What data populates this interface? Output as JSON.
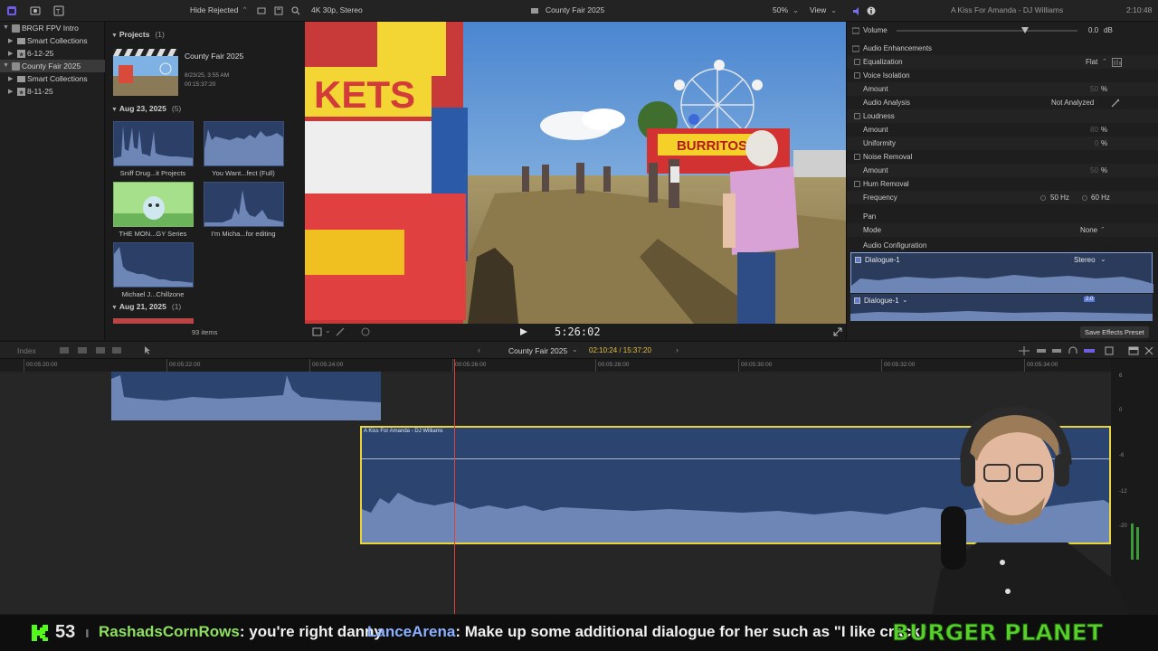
{
  "toolbar": {
    "hide_rejected": "Hide Rejected",
    "format": "4K 30p, Stereo",
    "project_title": "County Fair 2025",
    "zoom": "50%",
    "view": "View",
    "inspector_title": "A Kiss For Amanda - DJ Williams",
    "inspector_duration": "2:10:48"
  },
  "libraries": {
    "items": [
      {
        "label": "BRGR FPV Intro",
        "level": 0,
        "type": "library"
      },
      {
        "label": "Smart Collections",
        "level": 1,
        "type": "folder"
      },
      {
        "label": "6-12-25",
        "level": 1,
        "type": "event"
      },
      {
        "label": "County Fair 2025",
        "level": 0,
        "type": "library",
        "selected": true
      },
      {
        "label": "Smart Collections",
        "level": 1,
        "type": "folder"
      },
      {
        "label": "8-11-25",
        "level": 1,
        "type": "event"
      }
    ]
  },
  "browser": {
    "projects_header": "Projects",
    "projects_count": "(1)",
    "project": {
      "name": "County Fair 2025",
      "date": "8/23/25, 3:55 AM",
      "duration": "00:15:37:20"
    },
    "group1_header": "Aug 23, 2025",
    "group1_count": "(5)",
    "clips": [
      {
        "name": "Sniff Drug...it Projects"
      },
      {
        "name": "You Want...fect (Full)"
      },
      {
        "name": "THE MON...GY Series"
      },
      {
        "name": "I'm Micha...for editing"
      },
      {
        "name": "Michael J...Chillzone"
      }
    ],
    "group2_header": "Aug 21, 2025",
    "group2_count": "(1)",
    "items_count": "93 items"
  },
  "viewer": {
    "timecode": "5:26:02",
    "sign_text": "KETS",
    "burritos_sign": "BURRITOS"
  },
  "inspector": {
    "volume_label": "Volume",
    "volume_value": "0.0",
    "volume_unit": "dB",
    "audio_enhancements": "Audio Enhancements",
    "equalization": "Equalization",
    "equalization_value": "Flat",
    "voice_isolation": "Voice Isolation",
    "amount1": "Amount",
    "amount1_value": "50",
    "percent": "%",
    "audio_analysis": "Audio Analysis",
    "audio_analysis_value": "Not Analyzed",
    "loudness": "Loudness",
    "amount2": "Amount",
    "amount2_value": "80",
    "uniformity": "Uniformity",
    "uniformity_value": "0",
    "noise_removal": "Noise Removal",
    "amount3": "Amount",
    "amount3_value": "50",
    "hum_removal": "Hum Removal",
    "frequency": "Frequency",
    "freq_50": "50 Hz",
    "freq_60": "60 Hz",
    "pan": "Pan",
    "mode": "Mode",
    "mode_value": "None",
    "audio_configuration": "Audio Configuration",
    "dialogue1": "Dialogue-1",
    "stereo": "Stereo",
    "dialogue1b": "Dialogue-1",
    "channel_badge": "2.0",
    "save_preset": "Save Effects Preset"
  },
  "timeline": {
    "index": "Index",
    "project": "County Fair 2025",
    "position": "02:10:24 / 15:37:20",
    "ruler": [
      "00:05:20:00",
      "00:05:22:00",
      "00:05:24:00",
      "00:05:26:00",
      "00:05:28:00",
      "00:05:30:00",
      "00:05:32:00",
      "00:05:34:00"
    ],
    "clip_title": "A Kiss For Amanda - DJ Williams",
    "meter_labels": [
      "6",
      "0",
      "-6",
      "-12",
      "-20"
    ]
  },
  "chat": {
    "count": "53",
    "user1": "RashadsCornRows",
    "msg1": ": you're right danny",
    "user2": "LanceArena",
    "msg2": ": Make up some additional dialogue for her such as \"I like crack\"",
    "brand": "BURGER PLANET"
  },
  "colors": {
    "accent": "#5b8cff",
    "selection_yellow": "#e8d43c",
    "playhead": "#e0403a",
    "clip_blue": "#2c4470",
    "chat_user1": "#8fe060",
    "chat_user2": "#8ab0ff",
    "brand_green": "#57d12a"
  }
}
